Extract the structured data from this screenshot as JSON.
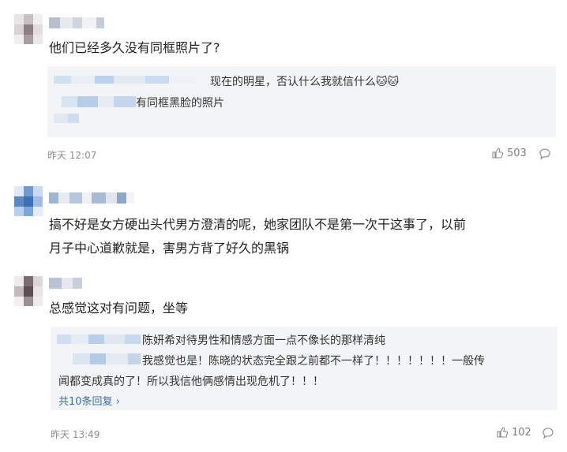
{
  "comments": [
    {
      "text": "他们已经多久没有同框照片了?",
      "quote": {
        "line1": "现在的明星，否认什么我就信什么",
        "line2": "有同框黑脸的照片",
        "emoji": "🐱🐱"
      },
      "time": "昨天 12:07",
      "likes": "503"
    },
    {
      "text_line1": "搞不好是女方硬出头代男方澄清的呢，她家团队不是第一次干这事了，以前",
      "text_line2": "月子中心道歉就是，害男方背了好久的黑锅"
    },
    {
      "text": "总感觉这对有问题，坐等",
      "quote": {
        "line1": "陈妍希对待男性和情感方面一点不像长的那样清纯",
        "line2": "我感觉也是！陈晓的状态完全跟之前都不一样了！！！！！！！一般传",
        "line3": "闻都变成真的了！所以我信他俩感情出现危机了！！！",
        "more": "共10条回复"
      },
      "time": "昨天 13:49",
      "likes": "102"
    }
  ],
  "icons": {
    "like": "thumbs-up-icon",
    "reply": "comment-bubble-icon",
    "more": "chevron-right-icon"
  },
  "colors": {
    "link": "#3b6ea8",
    "quote_bg": "#f3f4f6",
    "meta": "#8d8d8d"
  }
}
